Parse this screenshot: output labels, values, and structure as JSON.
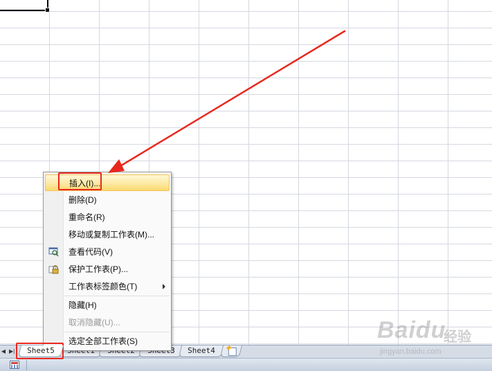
{
  "spreadsheet": {
    "sheet_tabs": [
      {
        "label": "Sheet5",
        "active": true
      },
      {
        "label": "Sheet1",
        "active": false
      },
      {
        "label": "Sheet2",
        "active": false
      },
      {
        "label": "Sheet3",
        "active": false
      },
      {
        "label": "Sheet4",
        "active": false
      }
    ],
    "new_sheet_icon": "insert-worksheet-icon"
  },
  "context_menu": {
    "items": [
      {
        "label": "插入(I)...",
        "highlighted": true
      },
      {
        "label": "删除(D)"
      },
      {
        "label": "重命名(R)"
      },
      {
        "label": "移动或复制工作表(M)..."
      },
      {
        "label": "查看代码(V)",
        "icon": "view-code-icon"
      },
      {
        "label": "保护工作表(P)...",
        "icon": "lock-icon"
      },
      {
        "label": "工作表标签颜色(T)",
        "submenu": true
      },
      {
        "label": "隐藏(H)"
      },
      {
        "label": "取消隐藏(U)...",
        "disabled": true
      },
      {
        "label": "选定全部工作表(S)"
      }
    ]
  },
  "annotation": {
    "color": "#e8281e"
  },
  "watermark": {
    "brand": "Baidu",
    "jingyan": "经验",
    "url": "jingyan.baidu.com"
  },
  "colors": {
    "menu_highlight": "#fde9a4",
    "tab_bar": "#d6dce6",
    "gridline": "#d4d8e0"
  }
}
